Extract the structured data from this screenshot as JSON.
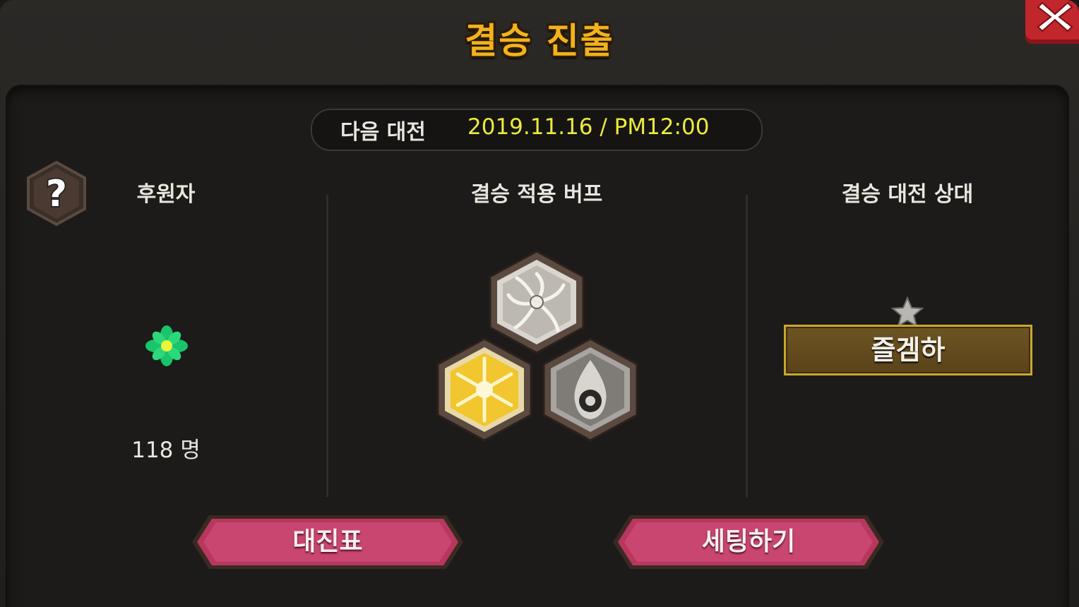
{
  "window": {
    "title": "결승 진출"
  },
  "schedule": {
    "label": "다음 대전",
    "datetime": "2019.11.16 / PM12:00"
  },
  "sponsors": {
    "heading": "후원자",
    "icon": "clover-icon",
    "count": "118 명"
  },
  "buffs": {
    "heading": "결승 적용 버프",
    "items": [
      {
        "icon": "white-swirl-buff-icon",
        "color": "#d9d6cf"
      },
      {
        "icon": "gold-sunburst-buff-icon",
        "color": "#f1c62e"
      },
      {
        "icon": "dark-flame-buff-icon",
        "color": "#8c8a85"
      }
    ]
  },
  "opponent": {
    "heading": "결승 대전 상대",
    "rank_icon": "star-icon",
    "name": "즐겜하"
  },
  "buttons": {
    "bracket": "대진표",
    "setup": "세팅하기"
  },
  "colors": {
    "title": "#f3b21d",
    "date": "#ecea3e",
    "button": "#b8375f",
    "close": "#c0262b"
  }
}
